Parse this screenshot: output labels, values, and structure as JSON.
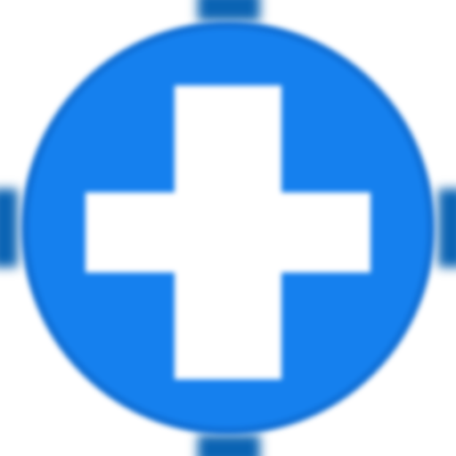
{
  "icon": {
    "name": "add-circle-icon",
    "fill_color": "#1580ee",
    "glyph_color": "#ffffff",
    "accent_color": "#0a63b3"
  }
}
